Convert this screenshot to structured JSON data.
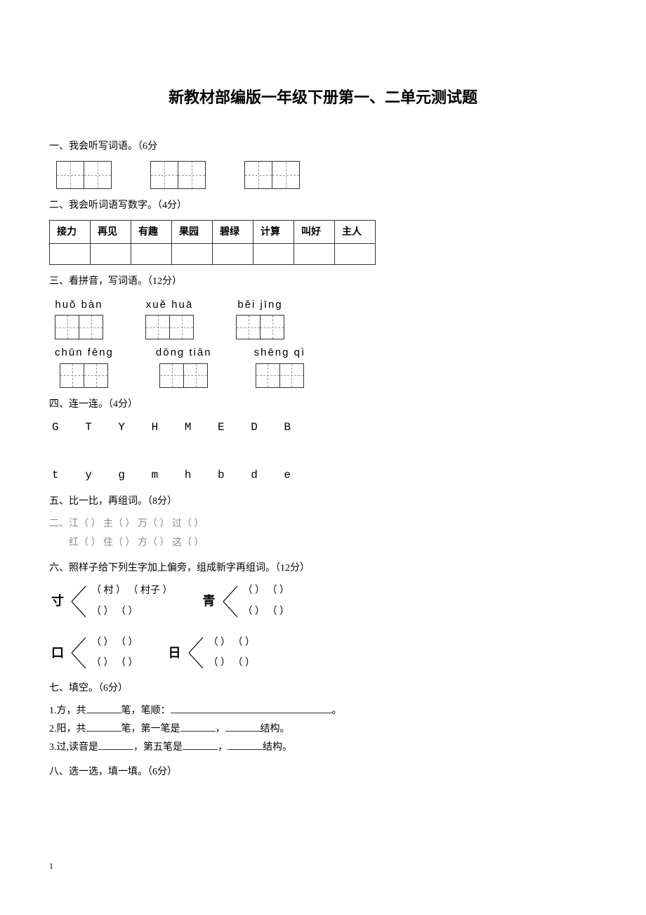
{
  "title": "新教材部编版一年级下册第一、二单元测试题",
  "s1": {
    "heading": "一、我会听写词语。（6分"
  },
  "s2": {
    "heading": "二、我会听词语写数字。（4分）",
    "cells": [
      "接力",
      "再见",
      "有趣",
      "果园",
      "碧绿",
      "计算",
      "叫好",
      "主人"
    ]
  },
  "s3": {
    "heading": "三、看拼音，写词语。（12分）",
    "row1": [
      {
        "pinyin": "huǒ   bàn"
      },
      {
        "pinyin": "xuě   huā"
      },
      {
        "pinyin": "běi   jīng"
      }
    ],
    "row2": [
      {
        "pinyin": "chūn  fēng"
      },
      {
        "pinyin": "dōng  tiān"
      },
      {
        "pinyin": "shēng qì"
      }
    ]
  },
  "s4": {
    "heading": "四、连一连。（4分）",
    "upper": "G  T  Y  H  M   E   D   B",
    "lower": "t  y  g  m  h   b   d   e"
  },
  "s5": {
    "heading": "五、比一比，再组词。（8分）",
    "line_label": "二、",
    "line1": "江（    ）    主（    ）    万（    ）    过（    ）",
    "line2": "红（    ）    住（    ）    方（    ）    这（    ）"
  },
  "s6": {
    "heading": "六、照样子给下列生字加上偏旁，组成新字再组词。（12分）",
    "blocks": [
      {
        "radical": "寸",
        "opt1": "（ 村 ）   （ 村子 ）",
        "opt2": "（     ）   （       ）"
      },
      {
        "radical": "青",
        "opt1": "（     ）   （       ）",
        "opt2": "（     ）   （       ）"
      },
      {
        "radical": "口",
        "opt1": "（     ）   （       ）",
        "opt2": "（     ）   （       ）"
      },
      {
        "radical": "日",
        "opt1": "（     ）   （       ）",
        "opt2": "（     ）   （       ）"
      }
    ]
  },
  "s7": {
    "heading": "七、填空。（6分）",
    "line1a": "1.方，共",
    "line1b": "笔，笔顺：",
    "line1c": "。",
    "line2a": "2.阳，共",
    "line2b": "笔，第一笔是",
    "line2c": "，",
    "line2d": "结构。",
    "line3a": "3.过,读音是",
    "line3b": "，第五笔是",
    "line3c": "，",
    "line3d": "结构。"
  },
  "s8": {
    "heading": "八、选一选，填一填。（6分）"
  },
  "page_number": "1"
}
